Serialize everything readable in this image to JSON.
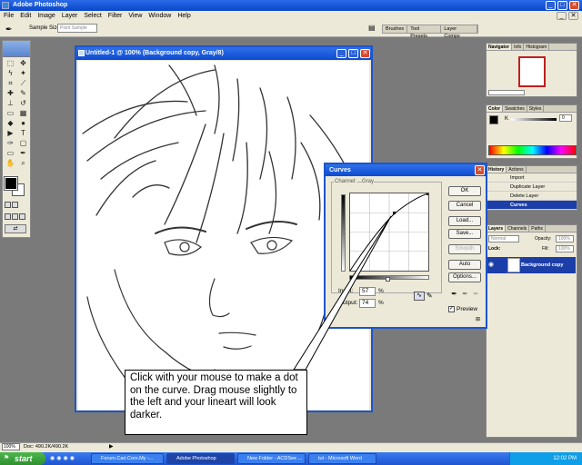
{
  "app": {
    "title": "Adobe Photoshop",
    "menu": [
      "File",
      "Edit",
      "Image",
      "Layer",
      "Select",
      "Filter",
      "View",
      "Window",
      "Help"
    ]
  },
  "options_bar": {
    "sample_size_label": "Sample Size:",
    "sample_size_value": "Point Sample",
    "palette_well": [
      "Brushes",
      "Tool Presets",
      "Layer Comps"
    ]
  },
  "document": {
    "title": "Untitled-1 @ 100% (Background copy, Gray/8)"
  },
  "curves_dialog": {
    "title": "Curves",
    "channel_label": "Channel:",
    "channel_value": "Gray",
    "buttons": [
      "OK",
      "Cancel",
      "Load...",
      "Save...",
      "Smooth",
      "Auto",
      "Options..."
    ],
    "input_label": "Input:",
    "input_value": "57",
    "output_label": "Output:",
    "output_value": "74",
    "percent": "%",
    "preview_label": "Preview",
    "preview_checked": true
  },
  "panels": {
    "navigator_tabs": [
      "Navigator",
      "Info",
      "Histogram"
    ],
    "color_tabs": [
      "Color",
      "Swatches",
      "Styles"
    ],
    "color_k_label": "K",
    "color_k_value": "0",
    "history_tabs": [
      "History",
      "Actions"
    ],
    "history_items": [
      "Import",
      "Duplicate Layer",
      "Delete Layer",
      "Curves"
    ],
    "layers_tabs": [
      "Layers",
      "Channels",
      "Paths"
    ],
    "blend_mode": "Normal",
    "opacity_label": "Opacity:",
    "opacity_value": "100%",
    "lock_label": "Lock:",
    "fill_label": "Fill:",
    "fill_value": "100%",
    "layer_name": "Background copy"
  },
  "status": {
    "zoom": "100%",
    "doc_info": "Doc: 490.2K/490.2K"
  },
  "taskbar": {
    "start_label": "start",
    "tasks": [
      "Forum.Cari.Com.My -...",
      "Adobe Photoshop",
      "New Folder - ACDSee ...",
      "tut - Microsoft Word"
    ],
    "clock": "12:02 PM"
  },
  "callout_text": "Click with your mouse to make a dot on the curve. Drag mouse slightly to the left and your lineart will look darker."
}
